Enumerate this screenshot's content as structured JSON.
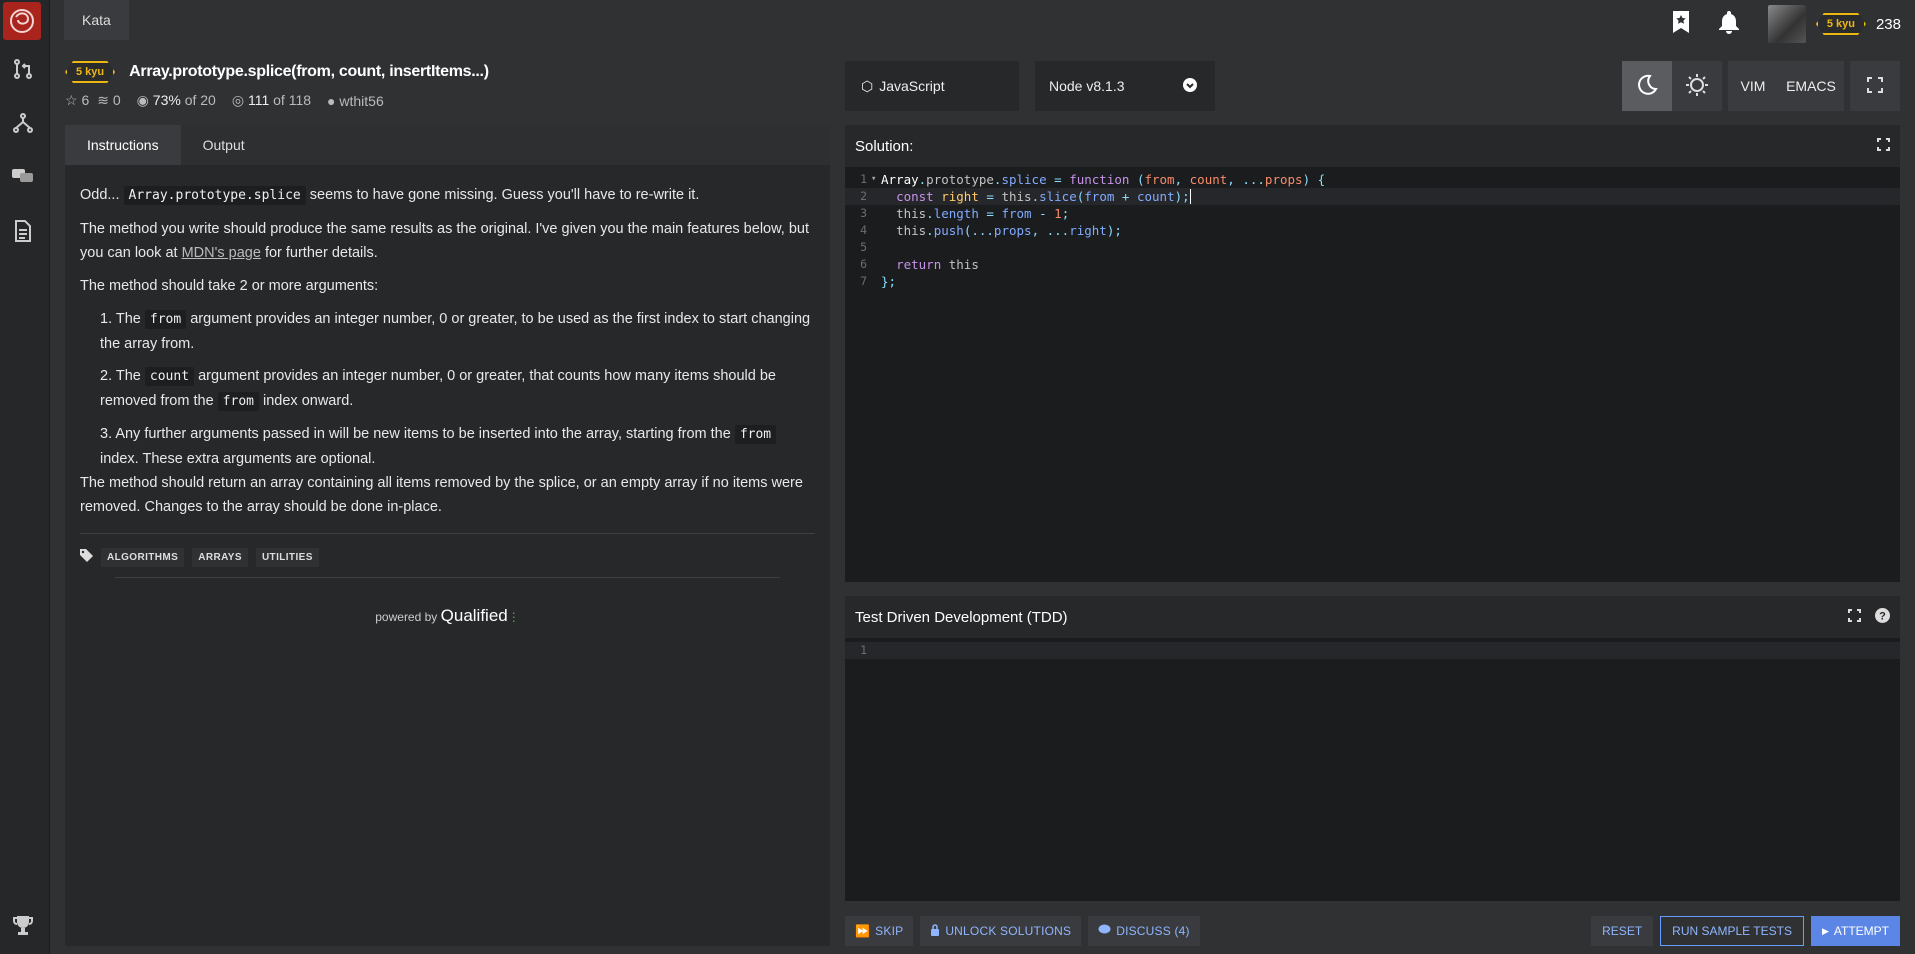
{
  "topbar": {
    "crumb": "Kata",
    "rank": "5 kyu",
    "honor": "238"
  },
  "kata": {
    "rank": "5 kyu",
    "title": "Array.prototype.splice(from, count, insertItems...)",
    "stars": "6",
    "collections": "0",
    "satisfaction": "73%",
    "satisfaction_of": "of 20",
    "completed": "111",
    "completed_of": "of 118",
    "author": "wthit56"
  },
  "left_tabs": [
    "Instructions",
    "Output"
  ],
  "description": {
    "p1_a": "Odd...",
    "p1_code": "Array.prototype.splice",
    "p1_b": "seems to have gone missing. Guess you'll have to re-write it.",
    "p2_a": "The method you write should produce the same results as the original. I've given you the main features below, but you can look at",
    "p2_link": "MDN's page",
    "p2_b": "for further details.",
    "p3": "The method should take 2 or more arguments:",
    "li1_a": "1. The",
    "li1_code": "from",
    "li1_b": "argument provides an integer number, 0 or greater, to be used as the first index to start changing the array from.",
    "li2_a": "2. The",
    "li2_code": "count",
    "li2_b": "argument provides an integer number, 0 or greater, that counts how many items should be removed from the",
    "li2_code2": "from",
    "li2_c": "index onward.",
    "li3_a": "3. Any further arguments passed in will be new items to be inserted into the array, starting from the",
    "li3_code": "from",
    "li3_b": "index. These extra arguments are optional.",
    "p4": "The method should return an array containing all items removed by the splice, or an empty array if no items were removed. Changes to the array should be done in-place."
  },
  "tags": [
    "ALGORITHMS",
    "ARRAYS",
    "UTILITIES"
  ],
  "powered": {
    "label": "powered by",
    "brand": "Qualified"
  },
  "language": "JavaScript",
  "version": "Node v8.1.3",
  "editor_modes": [
    "VIM",
    "EMACS"
  ],
  "solution": {
    "title": "Solution:",
    "line_numbers": [
      "1",
      "2",
      "3",
      "4",
      "5",
      "6",
      "7"
    ]
  },
  "tdd": {
    "title": "Test Driven Development (TDD)",
    "line_numbers": [
      "1"
    ]
  },
  "actions": {
    "skip": "SKIP",
    "unlock": "UNLOCK SOLUTIONS",
    "discuss": "DISCUSS (4)",
    "reset": "RESET",
    "run": "RUN SAMPLE TESTS",
    "attempt": "ATTEMPT"
  },
  "colors": {
    "rank_yellow": "#ecb613",
    "accent_blue": "#5b86e5",
    "logo_red": "#a8241d"
  }
}
